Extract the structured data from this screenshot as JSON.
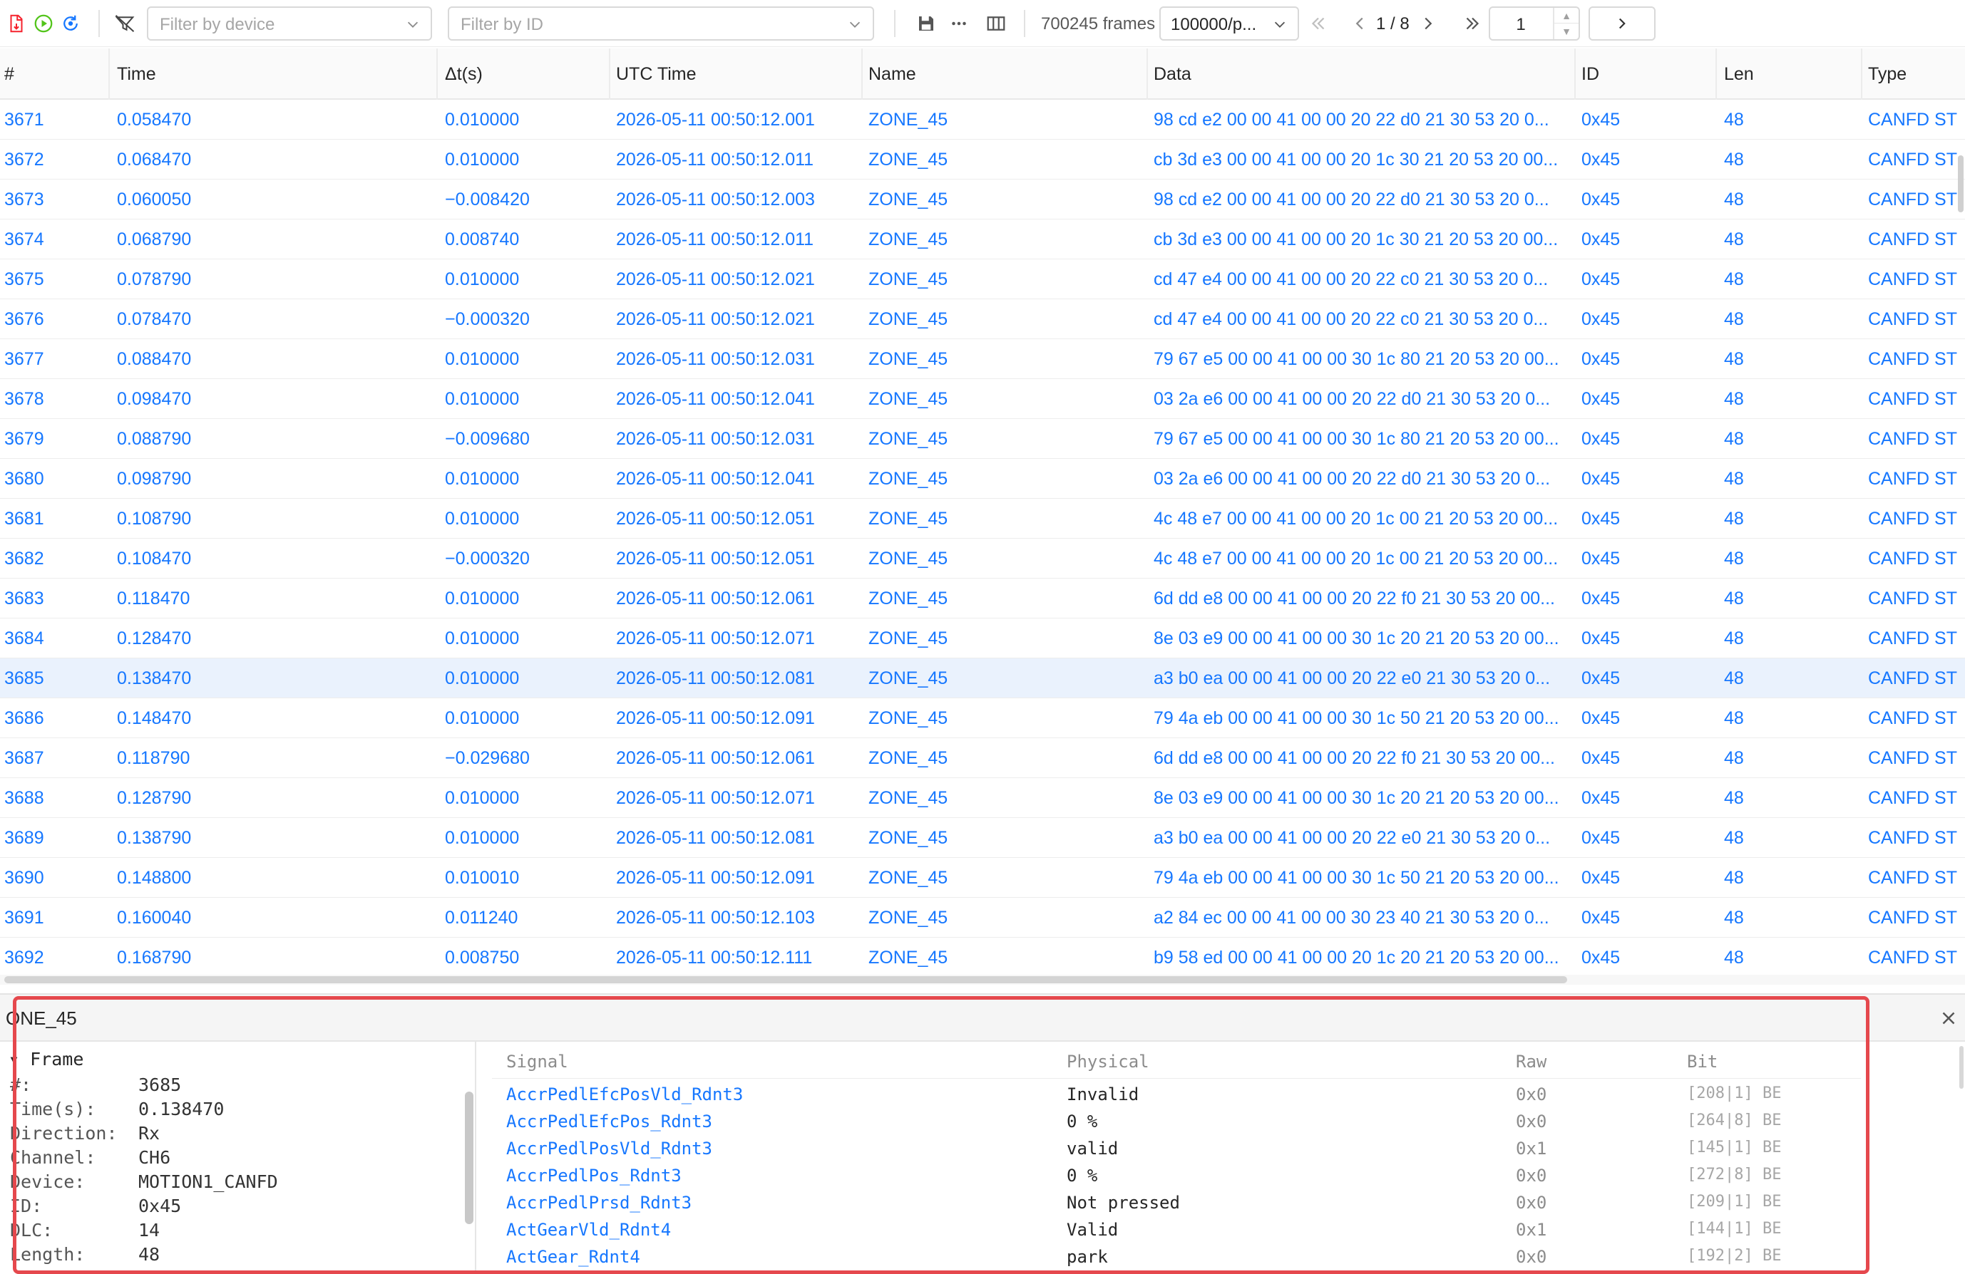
{
  "toolbar": {
    "device_filter_placeholder": "Filter by device",
    "id_filter_placeholder": "Filter by ID",
    "frames_count": "700245 frames",
    "page_size": "100000/p...",
    "page_indicator": "1 / 8",
    "page_input_value": "1",
    "icons": [
      "export-icon",
      "play-icon",
      "sync-icon",
      "clear-filter-icon",
      "save-icon",
      "more-icon",
      "columns-icon"
    ],
    "accent": "#1677ff"
  },
  "table": {
    "columns": [
      "#",
      "Time",
      "Δt(s)",
      "UTC Time",
      "Name",
      "Data",
      "ID",
      "Len",
      "Type"
    ],
    "selected_index": "3685",
    "rows": [
      {
        "n": "3671",
        "time": "0.058470",
        "dt": "0.010000",
        "utc": "2026-05-11 00:50:12.001",
        "name": "ZONE_45",
        "data": "98 cd e2 00 00 41 00 00 20 22 d0 21 30 53 20 0...",
        "id": "0x45",
        "len": "48",
        "type": "CANFD ST"
      },
      {
        "n": "3672",
        "time": "0.068470",
        "dt": "0.010000",
        "utc": "2026-05-11 00:50:12.011",
        "name": "ZONE_45",
        "data": "cb 3d e3 00 00 41 00 00 20 1c 30 21 20 53 20 00...",
        "id": "0x45",
        "len": "48",
        "type": "CANFD ST"
      },
      {
        "n": "3673",
        "time": "0.060050",
        "dt": "−0.008420",
        "utc": "2026-05-11 00:50:12.003",
        "name": "ZONE_45",
        "data": "98 cd e2 00 00 41 00 00 20 22 d0 21 30 53 20 0...",
        "id": "0x45",
        "len": "48",
        "type": "CANFD ST"
      },
      {
        "n": "3674",
        "time": "0.068790",
        "dt": "0.008740",
        "utc": "2026-05-11 00:50:12.011",
        "name": "ZONE_45",
        "data": "cb 3d e3 00 00 41 00 00 20 1c 30 21 20 53 20 00...",
        "id": "0x45",
        "len": "48",
        "type": "CANFD ST"
      },
      {
        "n": "3675",
        "time": "0.078790",
        "dt": "0.010000",
        "utc": "2026-05-11 00:50:12.021",
        "name": "ZONE_45",
        "data": "cd 47 e4 00 00 41 00 00 20 22 c0 21 30 53 20 0...",
        "id": "0x45",
        "len": "48",
        "type": "CANFD ST"
      },
      {
        "n": "3676",
        "time": "0.078470",
        "dt": "−0.000320",
        "utc": "2026-05-11 00:50:12.021",
        "name": "ZONE_45",
        "data": "cd 47 e4 00 00 41 00 00 20 22 c0 21 30 53 20 0...",
        "id": "0x45",
        "len": "48",
        "type": "CANFD ST"
      },
      {
        "n": "3677",
        "time": "0.088470",
        "dt": "0.010000",
        "utc": "2026-05-11 00:50:12.031",
        "name": "ZONE_45",
        "data": "79 67 e5 00 00 41 00 00 30 1c 80 21 20 53 20 00...",
        "id": "0x45",
        "len": "48",
        "type": "CANFD ST"
      },
      {
        "n": "3678",
        "time": "0.098470",
        "dt": "0.010000",
        "utc": "2026-05-11 00:50:12.041",
        "name": "ZONE_45",
        "data": "03 2a e6 00 00 41 00 00 20 22 d0 21 30 53 20 0...",
        "id": "0x45",
        "len": "48",
        "type": "CANFD ST"
      },
      {
        "n": "3679",
        "time": "0.088790",
        "dt": "−0.009680",
        "utc": "2026-05-11 00:50:12.031",
        "name": "ZONE_45",
        "data": "79 67 e5 00 00 41 00 00 30 1c 80 21 20 53 20 00...",
        "id": "0x45",
        "len": "48",
        "type": "CANFD ST"
      },
      {
        "n": "3680",
        "time": "0.098790",
        "dt": "0.010000",
        "utc": "2026-05-11 00:50:12.041",
        "name": "ZONE_45",
        "data": "03 2a e6 00 00 41 00 00 20 22 d0 21 30 53 20 0...",
        "id": "0x45",
        "len": "48",
        "type": "CANFD ST"
      },
      {
        "n": "3681",
        "time": "0.108790",
        "dt": "0.010000",
        "utc": "2026-05-11 00:50:12.051",
        "name": "ZONE_45",
        "data": "4c 48 e7 00 00 41 00 00 20 1c 00 21 20 53 20 00...",
        "id": "0x45",
        "len": "48",
        "type": "CANFD ST"
      },
      {
        "n": "3682",
        "time": "0.108470",
        "dt": "−0.000320",
        "utc": "2026-05-11 00:50:12.051",
        "name": "ZONE_45",
        "data": "4c 48 e7 00 00 41 00 00 20 1c 00 21 20 53 20 00...",
        "id": "0x45",
        "len": "48",
        "type": "CANFD ST"
      },
      {
        "n": "3683",
        "time": "0.118470",
        "dt": "0.010000",
        "utc": "2026-05-11 00:50:12.061",
        "name": "ZONE_45",
        "data": "6d dd e8 00 00 41 00 00 20 22 f0 21 30 53 20 00...",
        "id": "0x45",
        "len": "48",
        "type": "CANFD ST"
      },
      {
        "n": "3684",
        "time": "0.128470",
        "dt": "0.010000",
        "utc": "2026-05-11 00:50:12.071",
        "name": "ZONE_45",
        "data": "8e 03 e9 00 00 41 00 00 30 1c 20 21 20 53 20 00...",
        "id": "0x45",
        "len": "48",
        "type": "CANFD ST"
      },
      {
        "n": "3685",
        "time": "0.138470",
        "dt": "0.010000",
        "utc": "2026-05-11 00:50:12.081",
        "name": "ZONE_45",
        "data": "a3 b0 ea 00 00 41 00 00 20 22 e0 21 30 53 20 0...",
        "id": "0x45",
        "len": "48",
        "type": "CANFD ST"
      },
      {
        "n": "3686",
        "time": "0.148470",
        "dt": "0.010000",
        "utc": "2026-05-11 00:50:12.091",
        "name": "ZONE_45",
        "data": "79 4a eb 00 00 41 00 00 30 1c 50 21 20 53 20 00...",
        "id": "0x45",
        "len": "48",
        "type": "CANFD ST"
      },
      {
        "n": "3687",
        "time": "0.118790",
        "dt": "−0.029680",
        "utc": "2026-05-11 00:50:12.061",
        "name": "ZONE_45",
        "data": "6d dd e8 00 00 41 00 00 20 22 f0 21 30 53 20 00...",
        "id": "0x45",
        "len": "48",
        "type": "CANFD ST"
      },
      {
        "n": "3688",
        "time": "0.128790",
        "dt": "0.010000",
        "utc": "2026-05-11 00:50:12.071",
        "name": "ZONE_45",
        "data": "8e 03 e9 00 00 41 00 00 30 1c 20 21 20 53 20 00...",
        "id": "0x45",
        "len": "48",
        "type": "CANFD ST"
      },
      {
        "n": "3689",
        "time": "0.138790",
        "dt": "0.010000",
        "utc": "2026-05-11 00:50:12.081",
        "name": "ZONE_45",
        "data": "a3 b0 ea 00 00 41 00 00 20 22 e0 21 30 53 20 0...",
        "id": "0x45",
        "len": "48",
        "type": "CANFD ST"
      },
      {
        "n": "3690",
        "time": "0.148800",
        "dt": "0.010010",
        "utc": "2026-05-11 00:50:12.091",
        "name": "ZONE_45",
        "data": "79 4a eb 00 00 41 00 00 30 1c 50 21 20 53 20 00...",
        "id": "0x45",
        "len": "48",
        "type": "CANFD ST"
      },
      {
        "n": "3691",
        "time": "0.160040",
        "dt": "0.011240",
        "utc": "2026-05-11 00:50:12.103",
        "name": "ZONE_45",
        "data": "a2 84 ec 00 00 41 00 00 30 23 40 21 30 53 20 0...",
        "id": "0x45",
        "len": "48",
        "type": "CANFD ST"
      },
      {
        "n": "3692",
        "time": "0.168790",
        "dt": "0.008750",
        "utc": "2026-05-11 00:50:12.111",
        "name": "ZONE_45",
        "data": "b9 58 ed 00 00 41 00 00 20 1c 20 21 20 53 20 00...",
        "id": "0x45",
        "len": "48",
        "type": "CANFD ST"
      }
    ]
  },
  "detail": {
    "title": "ONE_45",
    "frame_section": "Frame",
    "frame_fields": [
      {
        "key": "#:",
        "value": "3685"
      },
      {
        "key": "Time(s):",
        "value": "0.138470"
      },
      {
        "key": "Direction:",
        "value": "Rx"
      },
      {
        "key": "Channel:",
        "value": "CH6"
      },
      {
        "key": "Device:",
        "value": "MOTION1_CANFD"
      },
      {
        "key": "ID:",
        "value": "0x45"
      },
      {
        "key": "DLC:",
        "value": "14"
      },
      {
        "key": "Length:",
        "value": "48"
      }
    ],
    "signal_columns": [
      "Signal",
      "Physical",
      "Raw",
      "Bit"
    ],
    "signals": [
      {
        "name": "AccrPedlEfcPosVld_Rdnt3",
        "physical": "Invalid",
        "raw": "0x0",
        "bit": "[208|1] BE"
      },
      {
        "name": "AccrPedlEfcPos_Rdnt3",
        "physical": "0 %",
        "raw": "0x0",
        "bit": "[264|8] BE"
      },
      {
        "name": "AccrPedlPosVld_Rdnt3",
        "physical": "valid",
        "raw": "0x1",
        "bit": "[145|1] BE"
      },
      {
        "name": "AccrPedlPos_Rdnt3",
        "physical": "0 %",
        "raw": "0x0",
        "bit": "[272|8] BE"
      },
      {
        "name": "AccrPedlPrsd_Rdnt3",
        "physical": "Not pressed",
        "raw": "0x0",
        "bit": "[209|1] BE"
      },
      {
        "name": "ActGearVld_Rdnt4",
        "physical": "Valid",
        "raw": "0x1",
        "bit": "[144|1] BE"
      },
      {
        "name": "ActGear_Rdnt4",
        "physical": "park",
        "raw": "0x0",
        "bit": "[192|2] BE"
      }
    ],
    "highlight_color": "#e5484d"
  }
}
